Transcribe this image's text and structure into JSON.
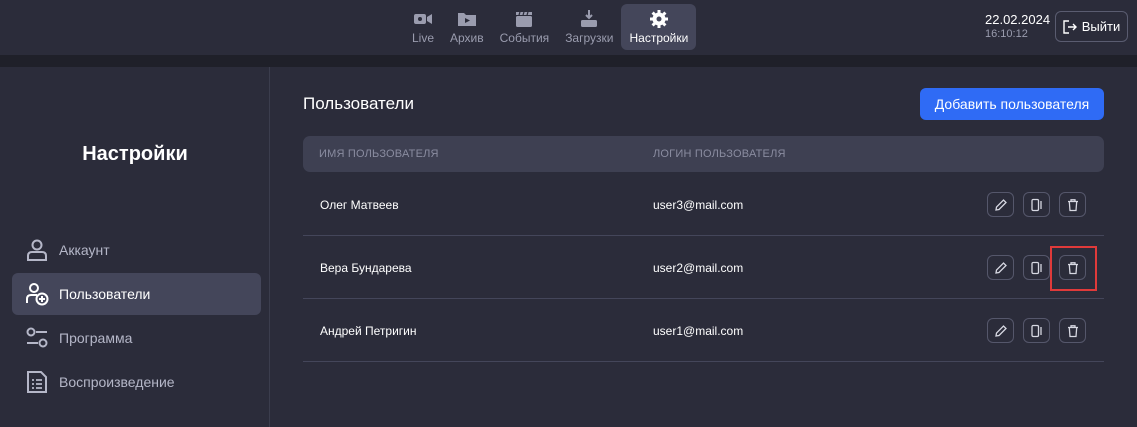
{
  "nav": {
    "items": [
      {
        "label": "Live",
        "icon": "video-camera-icon"
      },
      {
        "label": "Архив",
        "icon": "archive-folder-icon"
      },
      {
        "label": "События",
        "icon": "clapperboard-icon"
      },
      {
        "label": "Загрузки",
        "icon": "download-tray-icon"
      },
      {
        "label": "Настройки",
        "icon": "gear-icon",
        "active": true
      }
    ]
  },
  "clock": {
    "date": "22.02.2024",
    "time": "16:10:12"
  },
  "logout": {
    "label": "Выйти"
  },
  "sidebar": {
    "title": "Настройки",
    "items": [
      {
        "label": "Аккаунт",
        "icon": "user-icon"
      },
      {
        "label": "Пользователи",
        "icon": "user-add-icon",
        "active": true
      },
      {
        "label": "Программа",
        "icon": "sliders-icon"
      },
      {
        "label": "Воспроизведение",
        "icon": "document-list-icon"
      }
    ]
  },
  "main": {
    "title": "Пользователи",
    "add_button": "Добавить пользователя",
    "columns": {
      "name": "ИМЯ ПОЛЬЗОВАТЕЛЯ",
      "login": "ЛОГИН ПОЛЬЗОВАТЕЛЯ"
    },
    "rows": [
      {
        "name": "Олег Матвеев",
        "login": "user3@mail.com"
      },
      {
        "name": "Вера Бундарева",
        "login": "user2@mail.com"
      },
      {
        "name": "Андрей Петригин",
        "login": "user1@mail.com"
      }
    ],
    "actions": [
      "edit-pencil-icon",
      "mobile-device-icon",
      "trash-icon"
    ]
  },
  "colors": {
    "background": "#2b2c3a",
    "accent": "#2f6bf5",
    "highlight": "#e03a3a"
  }
}
